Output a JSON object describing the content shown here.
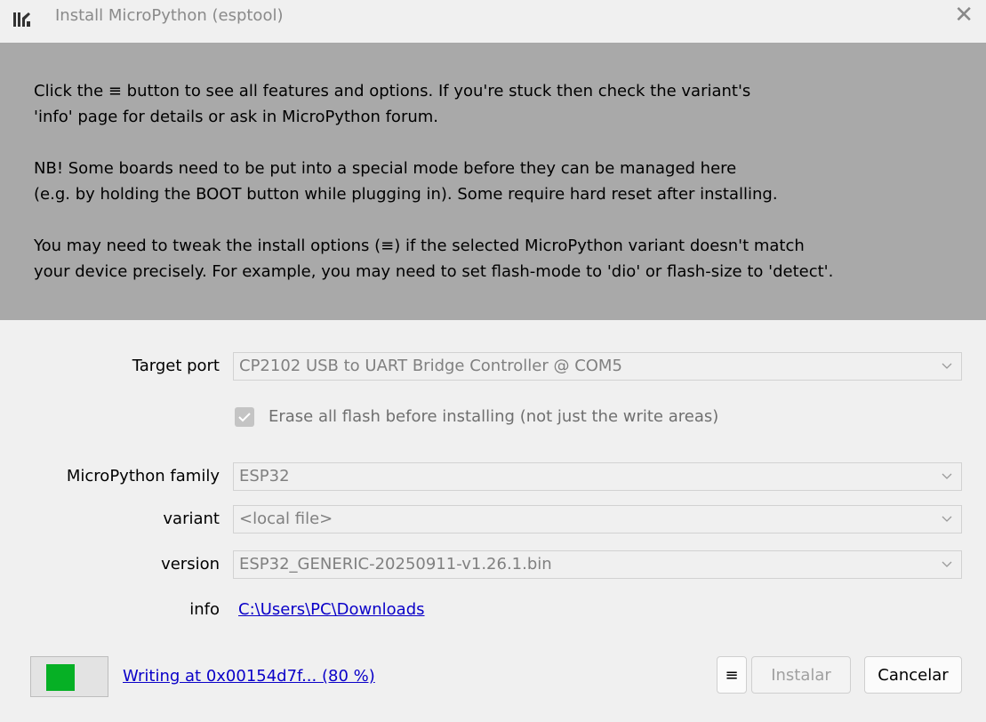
{
  "window": {
    "title": "Install MicroPython (esptool)",
    "close_glyph": "✕",
    "icon": "thonny-app-icon"
  },
  "banner": {
    "paragraph1_line1": "Click the ≡ button to see all features and options. If you're stuck then check the variant's",
    "paragraph1_line2": "'info' page for details or ask in MicroPython forum.",
    "paragraph2_line1": "NB! Some boards need to be put into a special mode before they can be managed here",
    "paragraph2_line2": "(e.g. by holding the BOOT button while plugging in). Some require hard reset after installing.",
    "paragraph3_line1": "You may need to tweak the install options (≡) if the selected MicroPython variant doesn't match",
    "paragraph3_line2": "your device precisely. For example, you may need to set flash-mode to 'dio' or flash-size to 'detect'."
  },
  "form": {
    "target_port_label": "Target port",
    "target_port_value": "CP2102 USB to UART Bridge Controller @ COM5",
    "erase_label": "Erase all flash before installing (not just the write areas)",
    "erase_checked": true,
    "family_label": "MicroPython family",
    "family_value": "ESP32",
    "variant_label": "variant",
    "variant_value": "<local file>",
    "version_label": "version",
    "version_value": "ESP32_GENERIC-20250911-v1.26.1.bin",
    "info_label": "info",
    "info_link": "C:\\Users\\PC\\Downloads"
  },
  "footer": {
    "progress_percent": 80,
    "progress_color": "#06b025",
    "status_text": "Writing at 0x00154d7f... (80 %)",
    "menu_button": "≡",
    "install_button": "Instalar",
    "cancel_button": "Cancelar"
  },
  "colors": {
    "banner_bg": "#a9a9a9",
    "link": "#0a00c8",
    "window_bg": "#f0f0f0"
  }
}
